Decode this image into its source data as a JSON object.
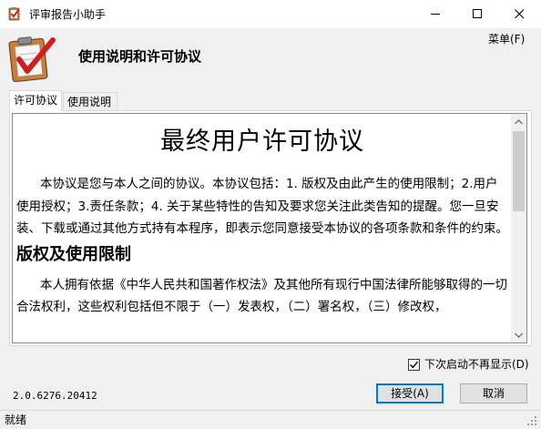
{
  "window": {
    "title": "评审报告小助手",
    "menu_label": "菜单(F)",
    "header_title": "使用说明和许可协议"
  },
  "tabs": [
    {
      "label": "许可协议",
      "active": true
    },
    {
      "label": "使用说明",
      "active": false
    }
  ],
  "document": {
    "title": "最终用户许可协议",
    "paragraph1": "本协议是您与本人之间的协议。本协议包括：1. 版权及由此产生的使用限制；2.用户使用授权；3.责任条款；4. 关于某些特性的告知及要求您关注此类告知的提醒。您一旦安装、下载或通过其他方式持有本程序，即表示您同意接受本协议的各项条款和条件的约束。",
    "heading2": "版权及使用限制",
    "paragraph2": "本人拥有依据《中华人民共和国著作权法》及其他所有现行中国法律所能够取得的一切合法权利，这些权利包括但不限于（一）发表权，（二）署名权，（三）修改权，"
  },
  "checkbox": {
    "label": "下次启动不再显示(D)",
    "checked": true
  },
  "version": "2.0.6276.20412",
  "buttons": {
    "accept": "接受(A)",
    "cancel": "取消"
  },
  "status": "就绪",
  "colors": {
    "accent": "#0078d7",
    "logo_check": "#cc1f1f",
    "logo_clipboard": "#c87f3a"
  }
}
